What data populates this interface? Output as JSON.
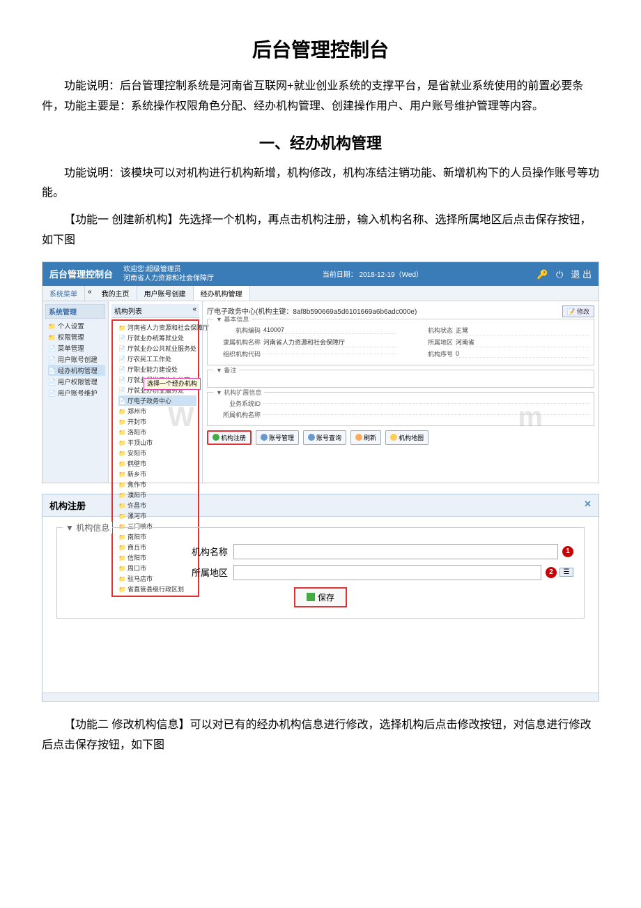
{
  "doc": {
    "title": "后台管理控制台",
    "intro": "功能说明：后台管理控制系统是河南省互联网+就业创业系统的支撑平台，是省就业系统使用的前置必要条件，功能主要是：系统操作权限角色分配、经办机构管理、创建操作用户、用户账号维护管理等内容。",
    "section1_title": "一、经办机构管理",
    "section1_desc": "功能说明：该模块可以对机构进行机构新增，机构修改，机构冻结注销功能、新增机构下的人员操作账号等功能。",
    "func1": "【功能一 创建新机构】先选择一个机构，再点击机构注册，输入机构名称、选择所属地区后点击保存按钮，如下图",
    "func2": "【功能二 修改机构信息】可以对已有的经办机构信息进行修改，选择机构后点击修改按钮，对信息进行修改后点击保存按钮，如下图"
  },
  "app": {
    "logo": "后台管理控制台",
    "welcome_line1": "欢迎您:超级管理员",
    "welcome_line2": "河南省人力资源和社会保障厅",
    "date": "当前日期： 2018-12-19（Wed）",
    "logout": "退 出",
    "nav_label": "系统菜单",
    "tabs": [
      "我的主页",
      "用户账号创建",
      "经办机构管理"
    ],
    "active_tab": 2,
    "sidebar_title": "系统管理",
    "sidebar_items": [
      {
        "label": "个人设置",
        "folder": true
      },
      {
        "label": "权限管理",
        "folder": true
      },
      {
        "label": "菜单管理"
      },
      {
        "label": "用户账号创建"
      },
      {
        "label": "经办机构管理",
        "selected": true
      },
      {
        "label": "用户权限管理"
      },
      {
        "label": "用户账号维护"
      }
    ],
    "tree_title": "机构列表",
    "tree_root": "河南省人力资源和社会保障厅",
    "tree_docs": [
      "厅就业办统筹就业处",
      "厅就业办公共就业服务处",
      "厅农民工工作处",
      "厅职业能力建设处",
      "厅就业促进工作办公室",
      "厅就业办创业服务处",
      "厅电子政务中心"
    ],
    "tree_cities": [
      "郑州市",
      "开封市",
      "洛阳市",
      "平顶山市",
      "安阳市",
      "鹤壁市",
      "新乡市",
      "焦作市",
      "濮阳市",
      "许昌市",
      "漯河市",
      "三门峡市",
      "南阳市",
      "商丘市",
      "信阳市",
      "周口市",
      "驻马店市",
      "省直管县级行政区划"
    ],
    "tree_selected": "厅电子政务中心",
    "callout": "选择一个经办机构",
    "detail_title": "厅电子政务中心(机构主键：8af8b590669a5d6101669a6b6adc000e)",
    "modify_btn": "修改",
    "group_basic": "基本信息",
    "fields_basic": [
      {
        "label": "机构编码",
        "value": "410007"
      },
      {
        "label": "机构状态",
        "value": "正常"
      },
      {
        "label": "隶属机构名称",
        "value": "河南省人力资源和社会保障厅"
      },
      {
        "label": "所属地区",
        "value": "河南省"
      },
      {
        "label": "组织机构代码",
        "value": ""
      },
      {
        "label": "机构序号",
        "value": "0"
      }
    ],
    "group_remark": "备注",
    "group_ext": "机构扩展信息",
    "fields_ext": [
      {
        "label": "业务系统ID",
        "value": ""
      },
      {
        "label": "所属机构名称",
        "value": ""
      }
    ],
    "buttons": [
      {
        "label": "机构注册",
        "icon": "add",
        "highlight": true
      },
      {
        "label": "账号管理",
        "icon": "user"
      },
      {
        "label": "账号查询",
        "icon": "search"
      },
      {
        "label": "刷新",
        "icon": "refresh"
      },
      {
        "label": "机构地图",
        "icon": "home"
      }
    ],
    "watermark_left": "W",
    "watermark_right": "m"
  },
  "dialog": {
    "title": "机构注册",
    "group": "▼ 机构信息",
    "field_name": "机构名称",
    "field_region": "所属地区",
    "save": "保存",
    "marker1": "1",
    "marker2": "2",
    "close": "✕"
  }
}
